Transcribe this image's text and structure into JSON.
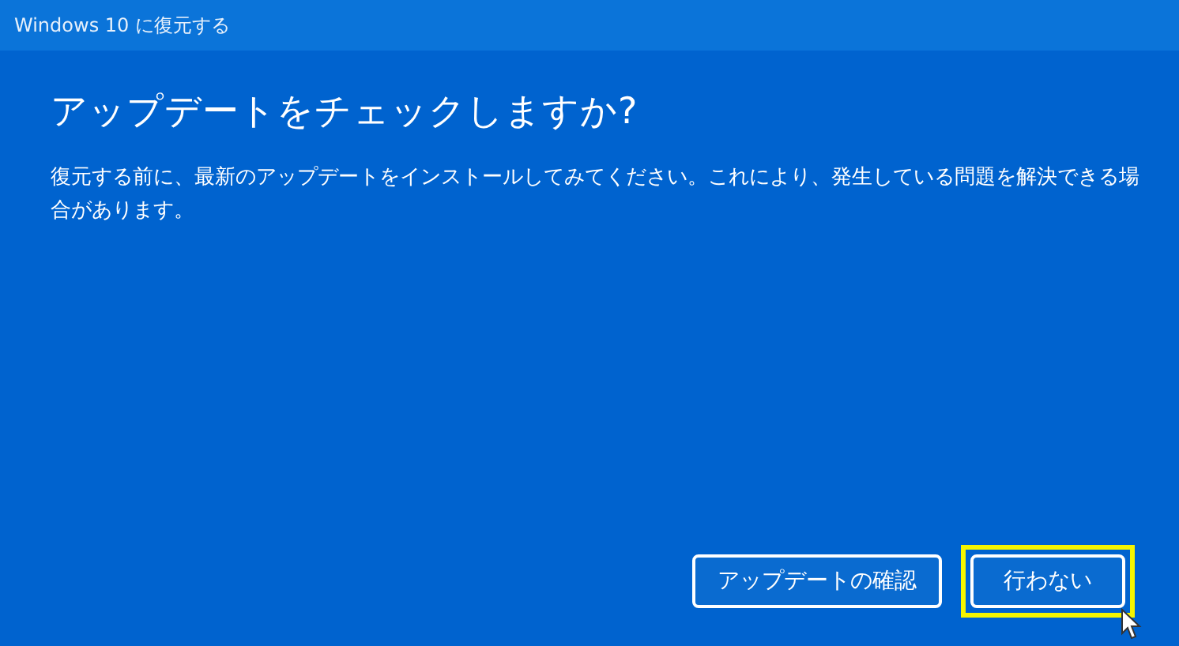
{
  "window": {
    "title": "Windows 10 に復元する"
  },
  "heading": "アップデートをチェックしますか?",
  "message": "復元する前に、最新のアップデートをインストールしてみてください。これにより、発生している問題を解決できる場合があります。",
  "buttons": [
    {
      "label": "アップデートの確認",
      "highlighted": false
    },
    {
      "label": "行わない",
      "highlighted": true
    }
  ]
}
